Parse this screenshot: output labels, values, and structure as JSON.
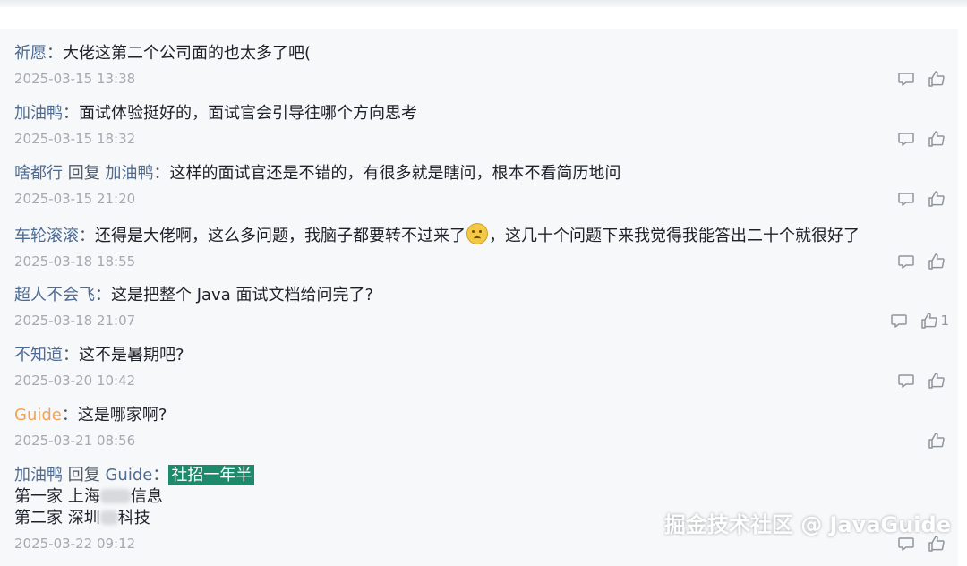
{
  "comments": [
    {
      "user": "祈愿",
      "sep": "：",
      "text": "大佬这第二个公司面的也太多了吧(",
      "time": "2025-03-15 13:38"
    },
    {
      "user": "加油鸭",
      "sep": "：",
      "text": "面试体验挺好的，面试官会引导往哪个方向思考",
      "time": "2025-03-15 18:32"
    },
    {
      "user": "啥都行",
      "reply_word": "回复",
      "reply_to": "加油鸭",
      "sep": "：",
      "text": "这样的面试官还是不错的，有很多就是瞎问，根本不看简历地问",
      "time": "2025-03-15 21:20"
    },
    {
      "user": "车轮滚滚",
      "sep": "：",
      "text_before": "还得是大佬啊，这么多问题，我脑子都要转不过来了",
      "text_after": "，这几十个问题下来我觉得我能答出二十个就很好了",
      "time": "2025-03-18 18:55"
    },
    {
      "user": "超人不会飞",
      "sep": "：",
      "text": "这是把整个 Java 面试文档给问完了?",
      "time": "2025-03-18 21:07",
      "likes": "1"
    },
    {
      "user": "不知道",
      "sep": "：",
      "text": "这不是暑期吧?",
      "time": "2025-03-20 10:42"
    },
    {
      "user": "Guide",
      "sep": "：",
      "text": "这是哪家啊?",
      "time": "2025-03-21 08:56"
    },
    {
      "user": "加油鸭",
      "reply_word": "回复",
      "reply_to": "Guide",
      "sep": "：",
      "highlight": "社招一年半",
      "line2_a": "第一家 上海",
      "line2_b": "信息",
      "line3_a": "第二家 深圳",
      "line3_b": "科技",
      "time": "2025-03-22 09:12"
    }
  ],
  "watermark": "掘金技术社区 @ JavaGuide",
  "colors": {
    "username": "#4e6b94",
    "author": "#f0a35a",
    "timestamp": "#a5a9b0",
    "highlight": "#1e8a6c"
  },
  "icons": {
    "reply": "comment-bubble-icon",
    "like": "thumbs-up-icon"
  }
}
